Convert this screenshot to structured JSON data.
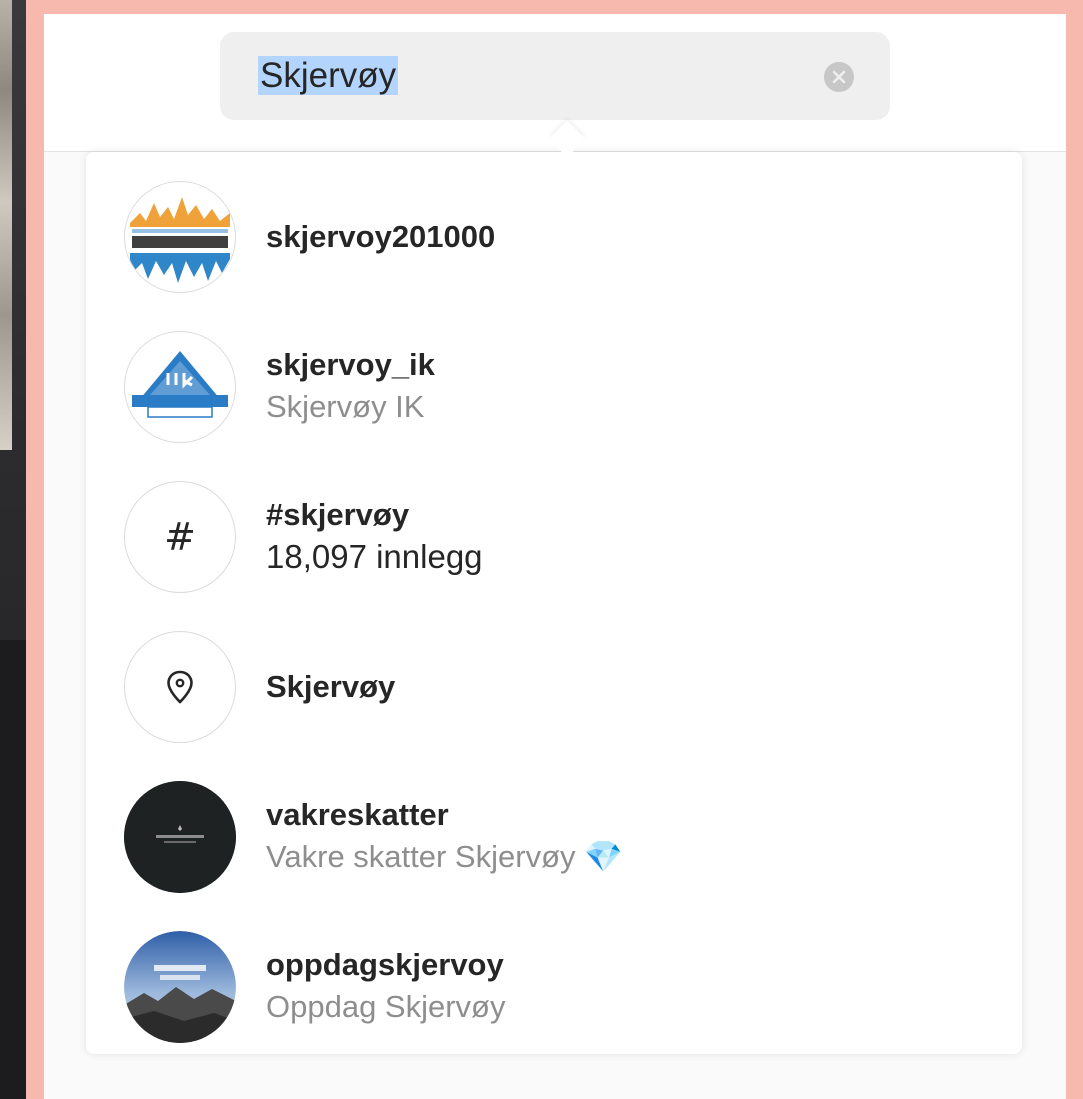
{
  "search": {
    "query": "Skjervøy"
  },
  "results": [
    {
      "kind": "account",
      "title": "skjervoy201000",
      "subtitle": "",
      "avatar": "skjervoy-20-1000-logo"
    },
    {
      "kind": "account",
      "title": "skjervoy_ik",
      "subtitle": "Skjervøy IK",
      "avatar": "sik-club-logo"
    },
    {
      "kind": "hashtag",
      "title": "#skjervøy",
      "subtitle": "18,097 innlegg",
      "avatar": "hash-icon"
    },
    {
      "kind": "place",
      "title": "Skjervøy",
      "subtitle": "",
      "avatar": "location-pin-icon"
    },
    {
      "kind": "account",
      "title": "vakreskatter",
      "subtitle": "Vakre skatter Skjervøy 💎",
      "avatar": "vakre-skatter-logo"
    },
    {
      "kind": "account",
      "title": "oppdagskjervoy",
      "subtitle": "Oppdag Skjervøy",
      "avatar": "oppdag-skjervoy-photo"
    }
  ],
  "colors": {
    "background": "#f7b8ad",
    "selection": "#b3d4fc",
    "title_text": "#262626",
    "subtitle_text": "#8e8e8e"
  }
}
